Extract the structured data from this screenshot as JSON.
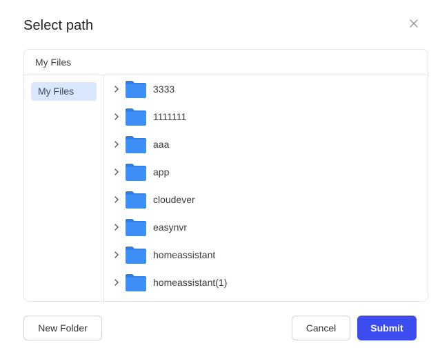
{
  "dialog": {
    "title": "Select path",
    "close_icon": "close-icon"
  },
  "breadcrumb": {
    "label": "My Files"
  },
  "sidebar": {
    "items": [
      {
        "label": "My Files",
        "selected": true
      }
    ]
  },
  "folders": [
    {
      "name": "3333"
    },
    {
      "name": "1111111"
    },
    {
      "name": "aaa"
    },
    {
      "name": "app"
    },
    {
      "name": "cloudever"
    },
    {
      "name": "easynvr"
    },
    {
      "name": "homeassistant"
    },
    {
      "name": "homeassistant(1)"
    },
    {
      "name": ""
    }
  ],
  "footer": {
    "new_folder_label": "New Folder",
    "cancel_label": "Cancel",
    "submit_label": "Submit"
  },
  "colors": {
    "accent": "#3b4df0",
    "folder": "#3d8ef7",
    "folder_tab": "#2f7fe8",
    "selected_bg": "#d9e8fc",
    "border": "#e2e5ea"
  }
}
